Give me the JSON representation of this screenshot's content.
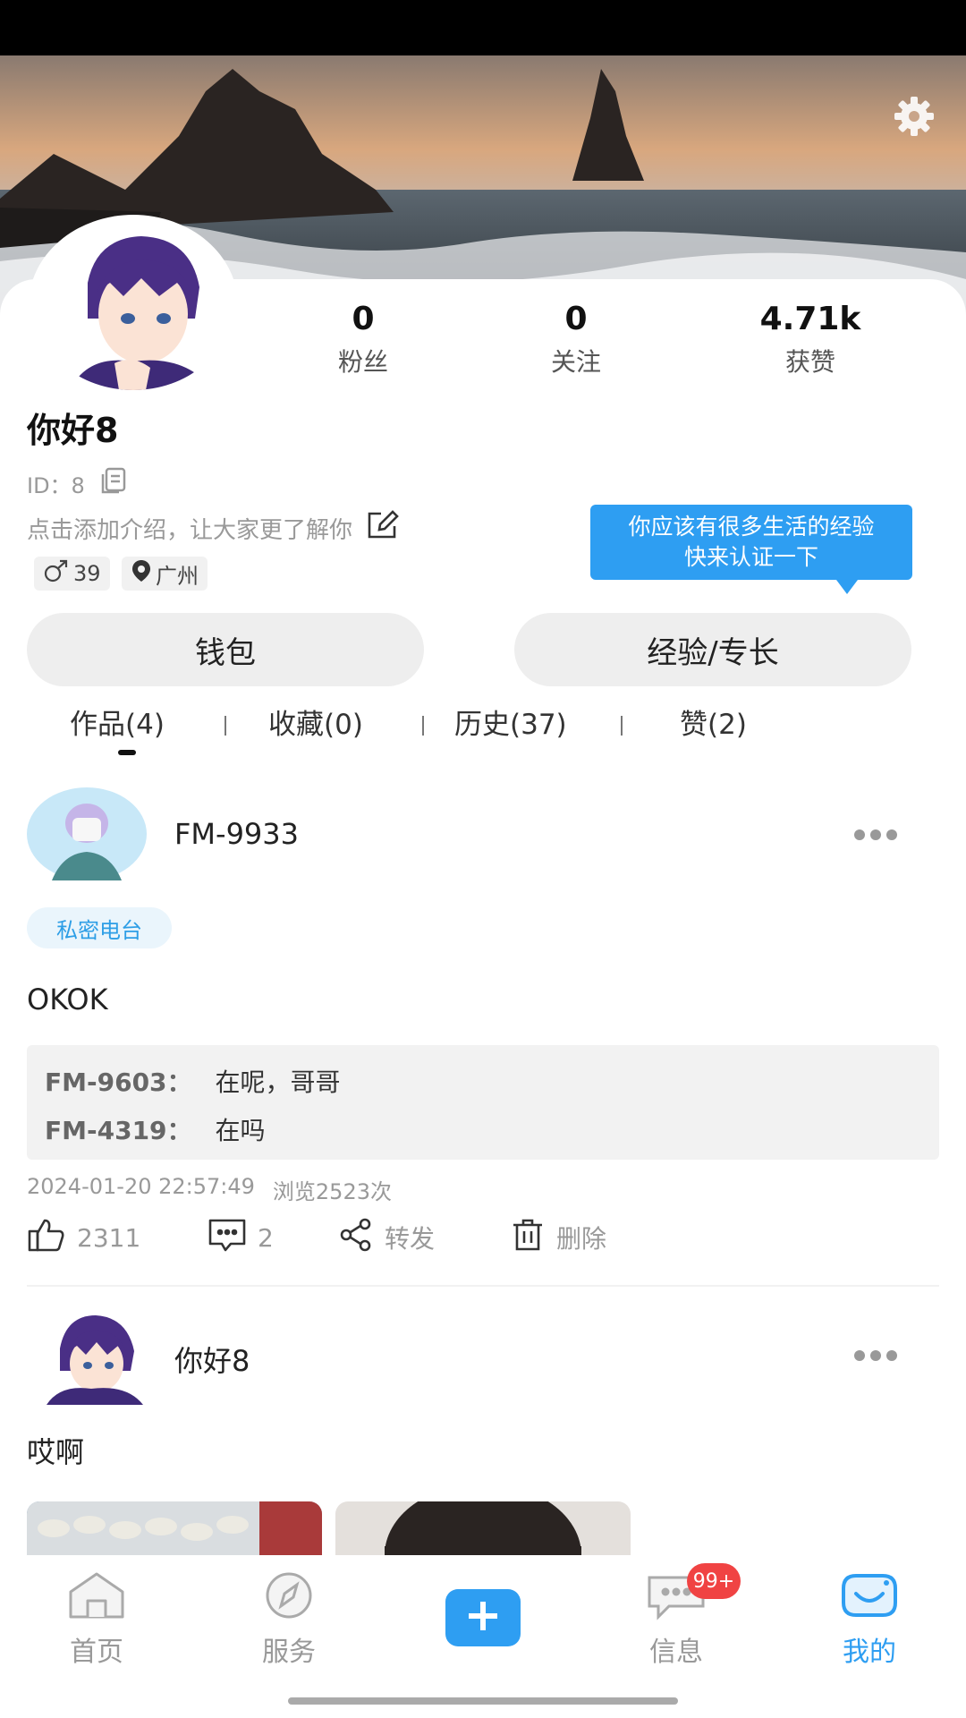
{
  "profile": {
    "stats": [
      {
        "value": "0",
        "label": "粉丝"
      },
      {
        "value": "0",
        "label": "关注"
      },
      {
        "value": "4.71k",
        "label": "获赞"
      }
    ],
    "username": "你好8",
    "id_text": "ID：8",
    "intro_placeholder": "点击添加介绍，让大家更了解你",
    "tags": {
      "gender_age": "39",
      "location": "广州"
    },
    "tooltip_line1": "你应该有很多生活的经验",
    "tooltip_line2": "快来认证一下",
    "wallet_label": "钱包",
    "experience_label": "经验/专长"
  },
  "tabs": [
    {
      "label": "作品(4)",
      "active": true
    },
    {
      "label": "收藏(0)"
    },
    {
      "label": "历史(37)"
    },
    {
      "label": "赞(2)"
    }
  ],
  "posts": [
    {
      "author": "FM-9933",
      "tag": "私密电台",
      "text": "OKOK",
      "comments": [
        {
          "user": "FM-9603：",
          "text": "在呢，哥哥"
        },
        {
          "user": "FM-4319：",
          "text": "在吗"
        }
      ],
      "timestamp": "2024-01-20 22:57:49",
      "views": "浏览2523次",
      "likes": "2311",
      "comment_count": "2",
      "share_label": "转发",
      "delete_label": "删除"
    },
    {
      "author": "你好8",
      "text": "哎啊"
    }
  ],
  "bottom_nav": {
    "home": "首页",
    "service": "服务",
    "messages": "信息",
    "messages_badge": "99+",
    "mine": "我的",
    "active": "mine"
  },
  "colors": {
    "accent": "#2e9ef2",
    "badge": "#f04343",
    "tag_bg": "#eaf5fc"
  },
  "icons": [
    "settings-icon",
    "copy-icon",
    "edit-icon",
    "male-icon",
    "location-icon",
    "like-icon",
    "comment-icon",
    "share-icon",
    "delete-icon",
    "home-icon",
    "compass-icon",
    "plus-icon",
    "chat-icon",
    "smile-icon"
  ]
}
